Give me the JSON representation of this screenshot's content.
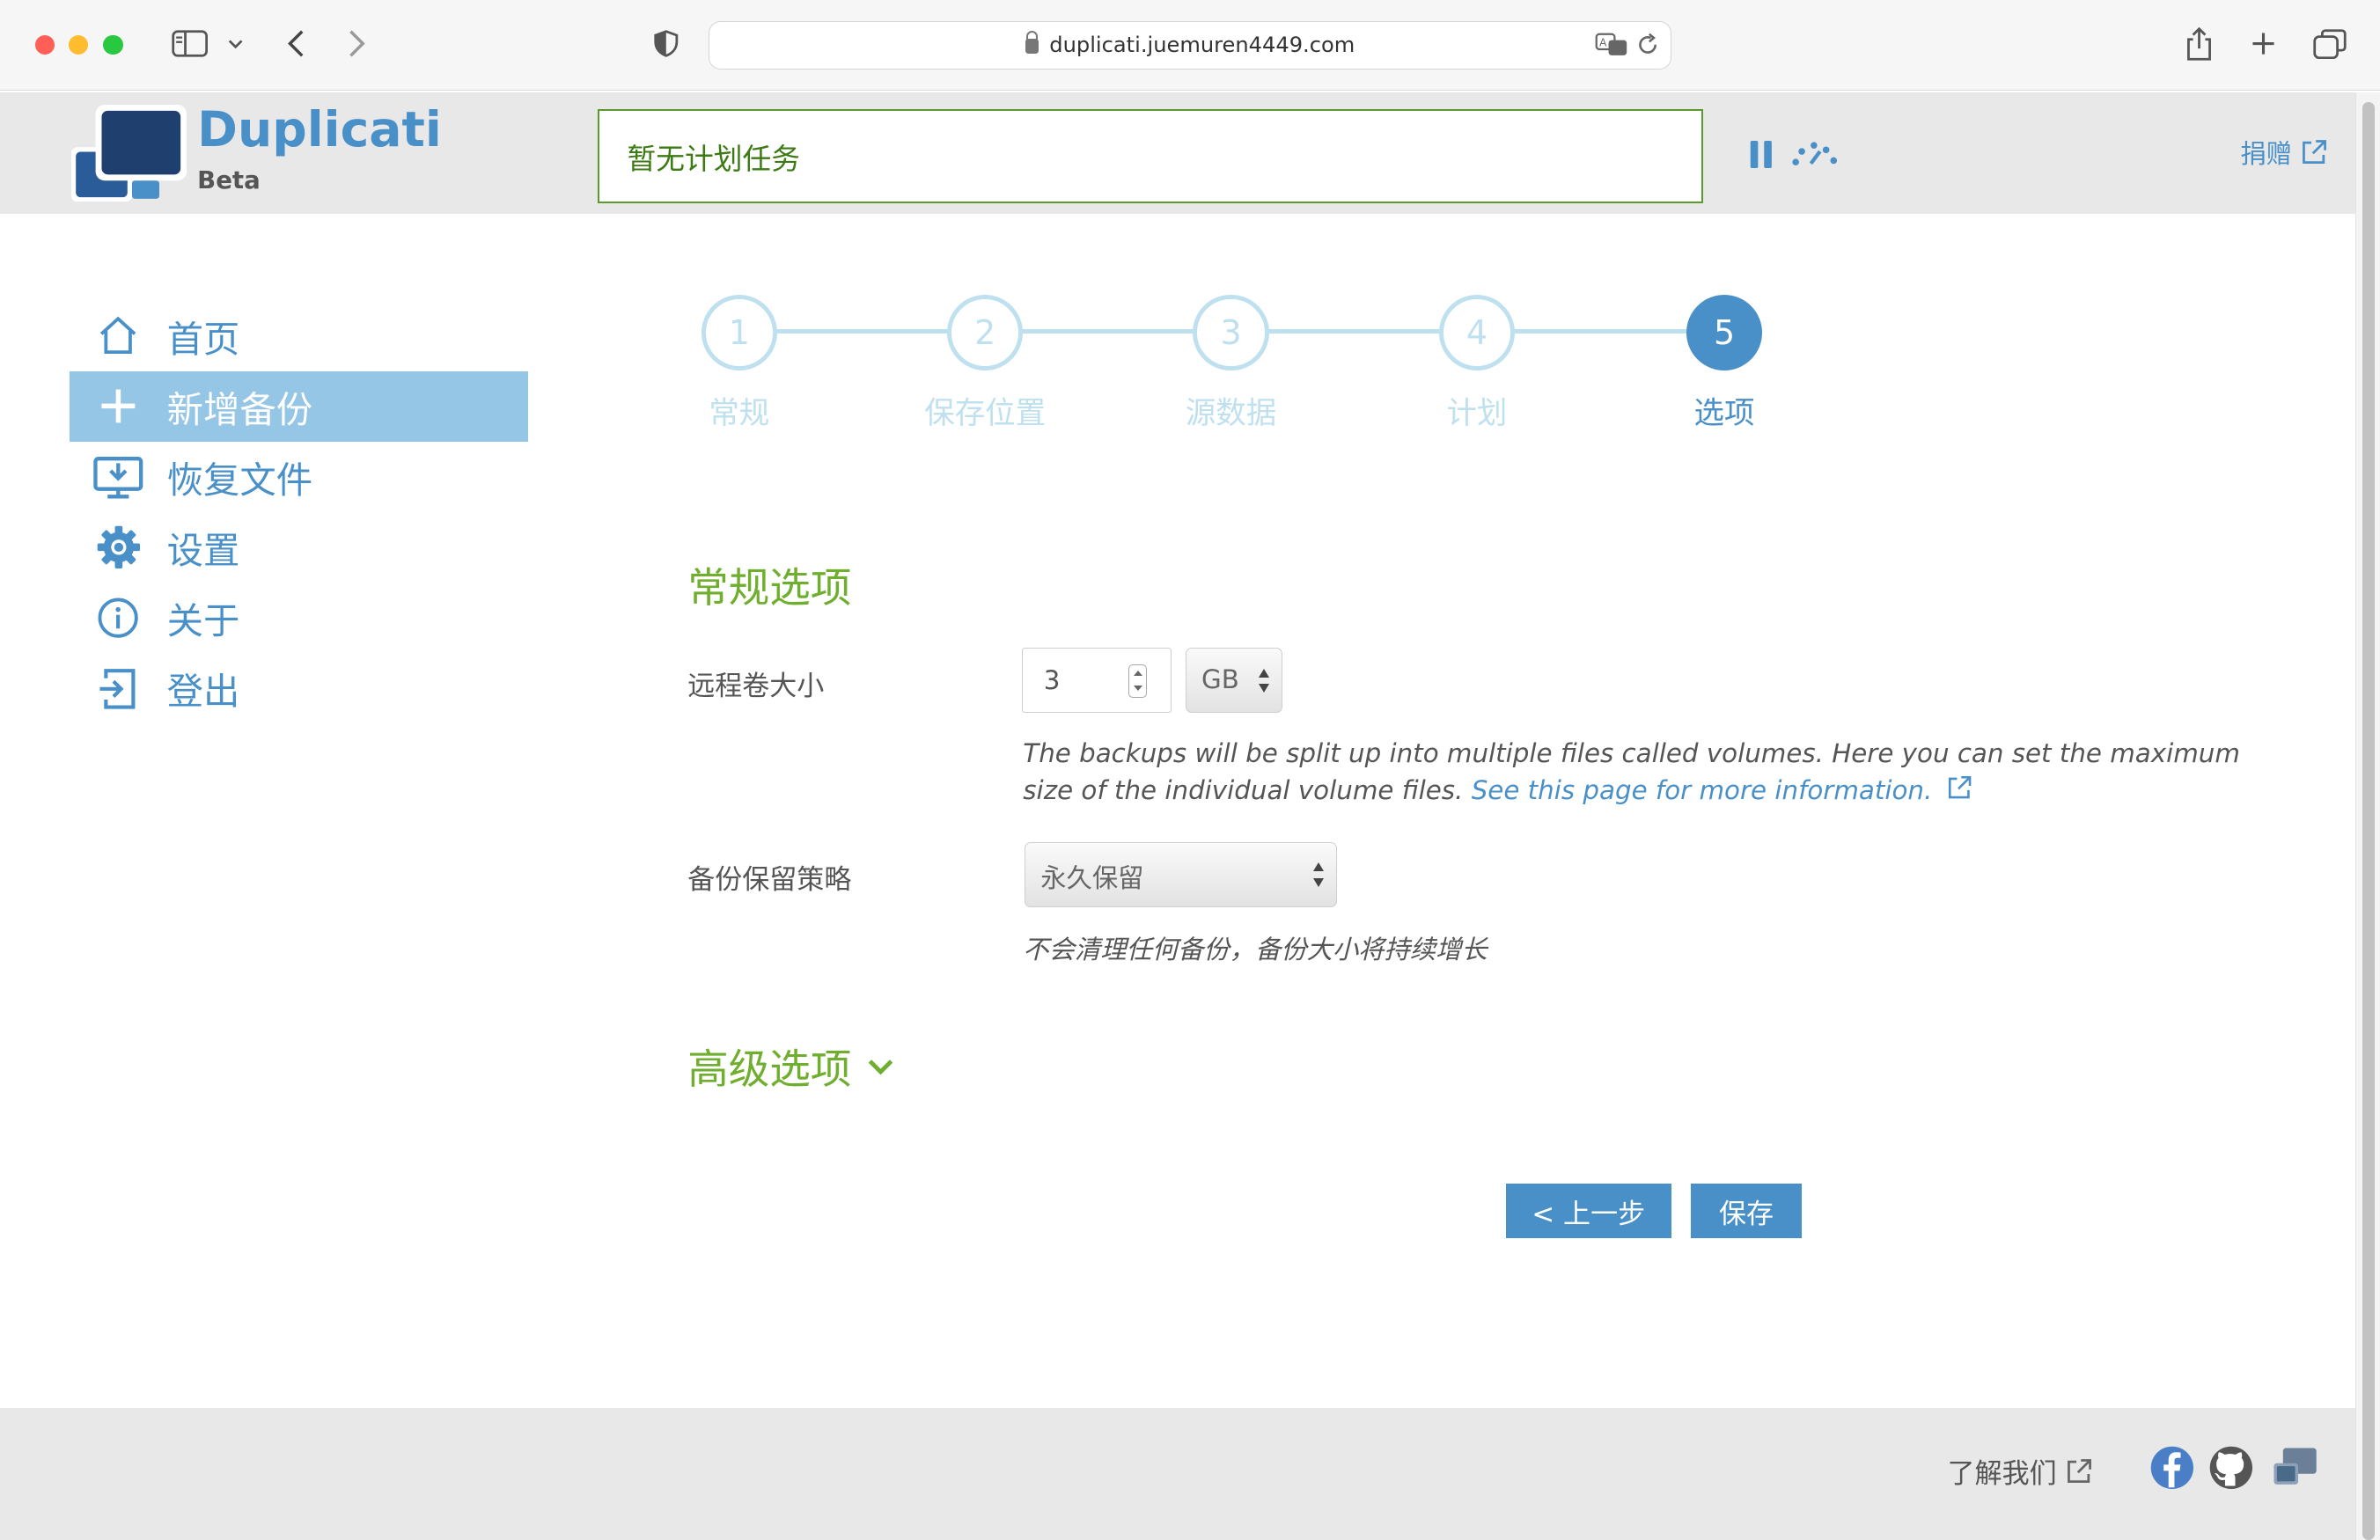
{
  "browser": {
    "url": "duplicati.juemuren4449.com"
  },
  "header": {
    "brand": "Duplicati",
    "beta": "Beta",
    "status": "暂无计划任务",
    "donate": "捐赠"
  },
  "sidebar": {
    "items": [
      {
        "label": "首页",
        "icon": "home-icon"
      },
      {
        "label": "新增备份",
        "icon": "plus-icon"
      },
      {
        "label": "恢复文件",
        "icon": "restore-icon"
      },
      {
        "label": "设置",
        "icon": "gear-icon"
      },
      {
        "label": "关于",
        "icon": "info-icon"
      },
      {
        "label": "登出",
        "icon": "logout-icon"
      }
    ]
  },
  "steps": {
    "items": [
      {
        "num": "1",
        "label": "常规"
      },
      {
        "num": "2",
        "label": "保存位置"
      },
      {
        "num": "3",
        "label": "源数据"
      },
      {
        "num": "4",
        "label": "计划"
      },
      {
        "num": "5",
        "label": "选项"
      }
    ]
  },
  "general": {
    "title": "常规选项",
    "volume_label": "远程卷大小",
    "volume_value": "3",
    "volume_unit": "GB",
    "volume_hint": "The backups will be split up into multiple files called volumes. Here you can set the maximum size of the individual volume files.",
    "volume_link": "See this page for more information.",
    "retention_label": "备份保留策略",
    "retention_value": "永久保留",
    "retention_hint": "不会清理任何备份，备份大小将持续增长"
  },
  "advanced": {
    "title": "高级选项"
  },
  "buttons": {
    "prev": "< 上一步",
    "save": "保存"
  },
  "footer": {
    "learn": "了解我们"
  },
  "colors": {
    "accent": "#4a90c8",
    "green": "#6fae2e",
    "active_nav": "#96c6e6"
  }
}
